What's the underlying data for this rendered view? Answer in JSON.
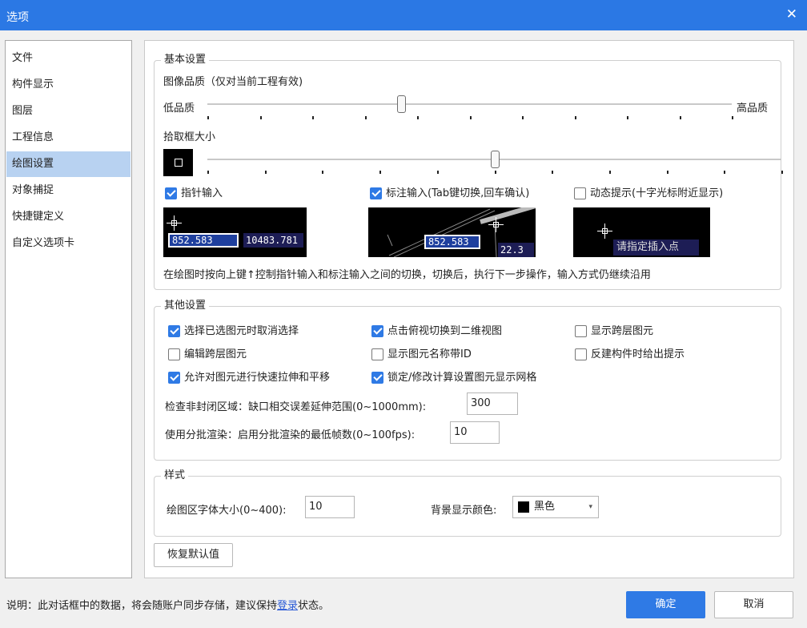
{
  "window": {
    "title": "选项",
    "close_icon": "✕"
  },
  "nav": {
    "items": [
      "文件",
      "构件显示",
      "图层",
      "工程信息",
      "绘图设置",
      "对象捕捉",
      "快捷键定义",
      "自定义选项卡"
    ],
    "active": "绘图设置"
  },
  "basic": {
    "title": "基本设置",
    "image_quality": {
      "label": "图像品质（仅对当前工程有效)",
      "low": "低品质",
      "high": "高品质",
      "value": 0.37
    },
    "pick_box": {
      "label": "拾取框大小",
      "value": 0.5
    },
    "checks": {
      "pointer_input": {
        "label": "指针输入",
        "checked": true
      },
      "dim_input": {
        "label": "标注输入(Tab键切换,回车确认)",
        "checked": true
      },
      "dynamic_tip": {
        "label": "动态提示(十字光标附近显示)",
        "checked": false
      }
    },
    "preview1": {
      "value1": "852.583",
      "value2": "10483.781"
    },
    "preview2": {
      "value1": "852.583",
      "value2": "22.3"
    },
    "preview3": {
      "prompt": "请指定插入点"
    },
    "hint": "在绘图时按向上键↑控制指针输入和标注输入之间的切换，切换后，执行下一步操作，输入方式仍继续沿用"
  },
  "other": {
    "title": "其他设置",
    "checks": [
      {
        "label": "选择已选图元时取消选择",
        "checked": true
      },
      {
        "label": "点击俯视切换到二维视图",
        "checked": true
      },
      {
        "label": "显示跨层图元",
        "checked": false
      },
      {
        "label": "编辑跨层图元",
        "checked": false
      },
      {
        "label": "显示图元名称带ID",
        "checked": false
      },
      {
        "label": "反建构件时给出提示",
        "checked": false
      },
      {
        "label": "允许对图元进行快速拉伸和平移",
        "checked": true
      },
      {
        "label": "锁定/修改计算设置图元显示网格",
        "checked": true
      }
    ],
    "gap_label": "检查非封闭区域：缺口相交误差延伸范围(0~1000mm):",
    "gap_value": "300",
    "batch_label": "使用分批渲染：启用分批渲染的最低帧数(0~100fps):",
    "batch_value": "10"
  },
  "style": {
    "title": "样式",
    "font_label": "绘图区字体大小(0~400):",
    "font_value": "10",
    "bg_label": "背景显示颜色:",
    "bg_value": "黑色",
    "bg_color": "#000000"
  },
  "restore_button": "恢复默认值",
  "footer": {
    "note_before": "说明：此对话框中的数据，将会随账户同步存储，建议保持",
    "note_link": "登录",
    "note_after": "状态。",
    "ok": "确定",
    "cancel": "取消"
  },
  "colors": {
    "accent": "#2f7ae5",
    "titlebar": "#2b78e4",
    "selection": "#b8d2f1"
  }
}
